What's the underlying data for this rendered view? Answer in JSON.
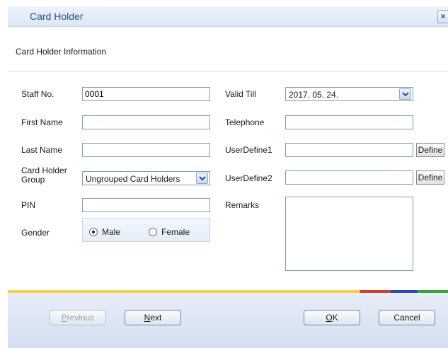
{
  "window": {
    "title": "Card Holder"
  },
  "header": {
    "label": "Card Holder Information"
  },
  "form": {
    "staff_no": {
      "label": "Staff No.",
      "value": "0001"
    },
    "first_name": {
      "label": "First Name",
      "value": ""
    },
    "last_name": {
      "label": "Last Name",
      "value": ""
    },
    "group": {
      "label_line1": "Card Holder",
      "label_line2": "Group",
      "value": "Ungrouped Card Holders"
    },
    "pin": {
      "label": "PIN",
      "value": ""
    },
    "gender": {
      "label": "Gender",
      "options": [
        "Male",
        "Female"
      ],
      "selected": "Male"
    },
    "valid_till": {
      "label": "Valid Till",
      "value": "2017. 05. 24."
    },
    "telephone": {
      "label": "Telephone",
      "value": ""
    },
    "userdefine1": {
      "label": "UserDefine1",
      "value": "",
      "button": "Define"
    },
    "userdefine2": {
      "label": "UserDefine2",
      "value": "",
      "button": "Define"
    },
    "remarks": {
      "label": "Remarks",
      "value": ""
    }
  },
  "footer": {
    "previous_first": "P",
    "previous_rest": "revious",
    "next_first": "N",
    "next_rest": "ext",
    "ok_first": "O",
    "ok_rest": "K",
    "cancel": "Cancel"
  },
  "colors": {
    "accent": "#2b4f82",
    "footer_bg": "#dce5f3",
    "stripe_yellow": "#f1d24a"
  },
  "icons": {
    "close": "close-icon",
    "dropdown": "chevron-down-icon"
  }
}
